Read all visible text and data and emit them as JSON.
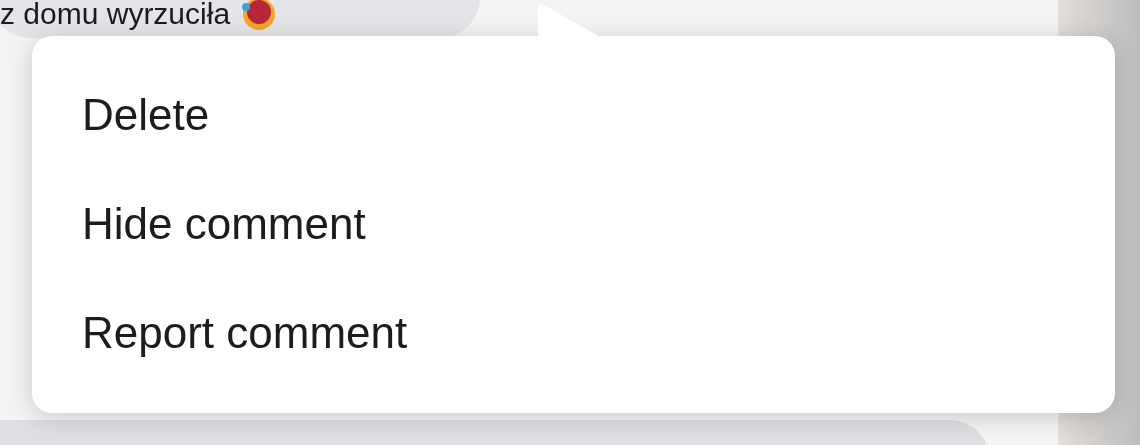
{
  "comment": {
    "text": "z domu wyrzuciła"
  },
  "menu": {
    "items": [
      {
        "label": "Delete"
      },
      {
        "label": "Hide comment"
      },
      {
        "label": "Report comment"
      }
    ]
  }
}
